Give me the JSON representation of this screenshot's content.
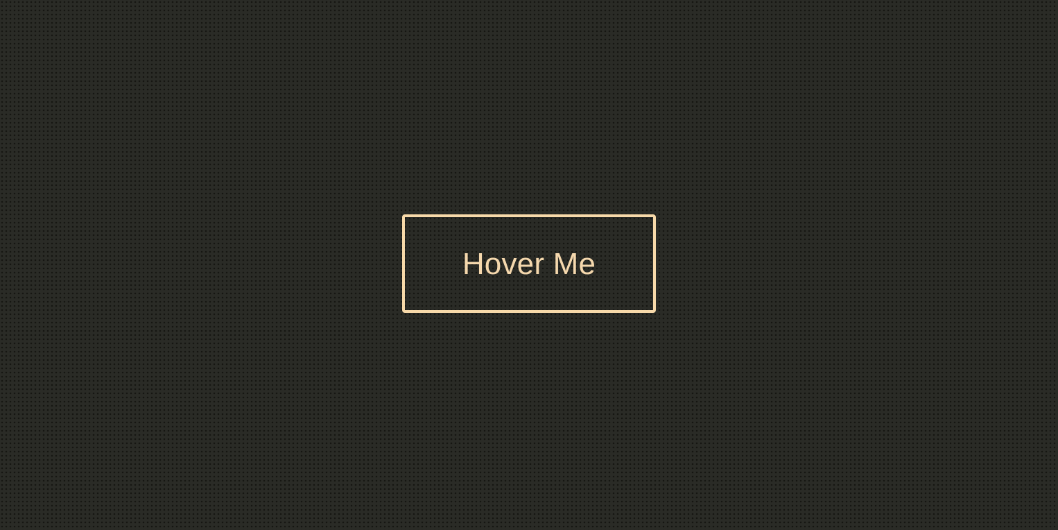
{
  "button": {
    "label": "Hover Me"
  },
  "colors": {
    "background": "#2a2b26",
    "dots": "#151611",
    "accent": "#f7d9a9"
  }
}
